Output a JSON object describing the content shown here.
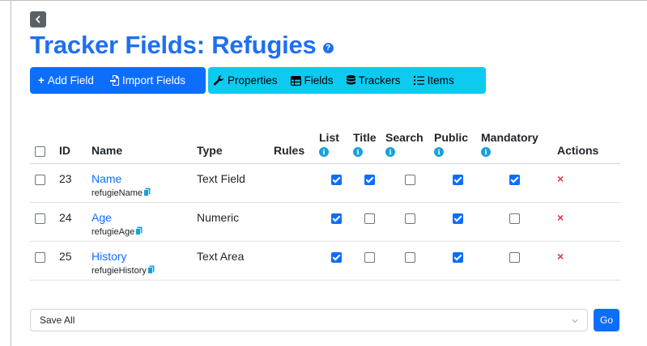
{
  "page": {
    "title": "Tracker Fields: Refugies",
    "back_icon": "chevron-left-icon",
    "help_icon": "question-circle-icon"
  },
  "toolbar": {
    "primary": [
      {
        "label": "Add Field",
        "icon": "plus-icon",
        "prefix": "+"
      },
      {
        "label": "Import Fields",
        "icon": "file-import-icon"
      }
    ],
    "secondary": [
      {
        "label": "Properties",
        "icon": "wrench-icon"
      },
      {
        "label": "Fields",
        "icon": "table-icon"
      },
      {
        "label": "Trackers",
        "icon": "database-icon"
      },
      {
        "label": "Items",
        "icon": "list-icon"
      }
    ],
    "colors": {
      "primary": "#0d6efd",
      "info": "#0dcaf0"
    }
  },
  "table": {
    "headers": {
      "id": "ID",
      "name": "Name",
      "type": "Type",
      "rules": "Rules",
      "list": "List",
      "title": "Title",
      "search": "Search",
      "public": "Public",
      "mandatory": "Mandatory",
      "actions": "Actions"
    },
    "rows": [
      {
        "id": "23",
        "name": "Name",
        "perm_name": "refugieName",
        "type": "Text Field",
        "list": true,
        "title": true,
        "search": false,
        "public": true,
        "mandatory": true
      },
      {
        "id": "24",
        "name": "Age",
        "perm_name": "refugieAge",
        "type": "Numeric",
        "list": true,
        "title": false,
        "search": false,
        "public": true,
        "mandatory": false
      },
      {
        "id": "25",
        "name": "History",
        "perm_name": "refugieHistory",
        "type": "Text Area",
        "list": true,
        "title": false,
        "search": false,
        "public": true,
        "mandatory": false
      }
    ],
    "delete_glyph": "×"
  },
  "footer": {
    "bulk_action": "Save All",
    "go_label": "Go"
  }
}
